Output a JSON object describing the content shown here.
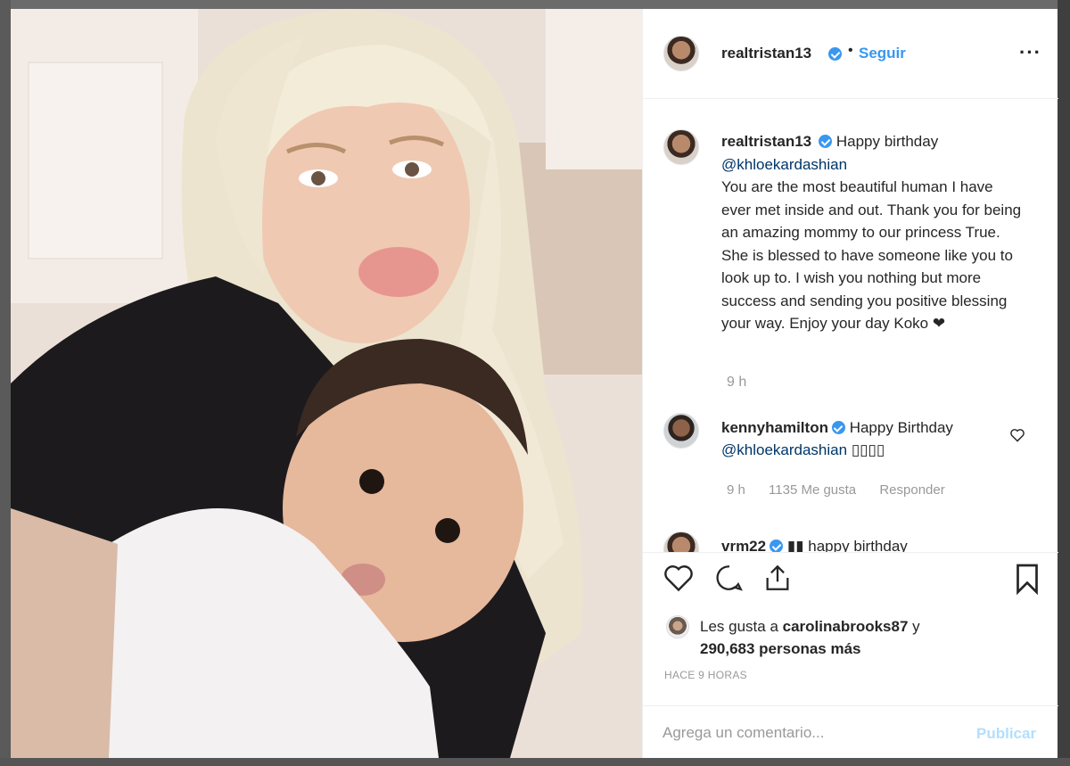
{
  "post": {
    "username": "realtristan13",
    "follow_label": "Seguir",
    "more_icon": "more-horizontal-icon",
    "dot": "•"
  },
  "caption": {
    "username": "realtristan13",
    "text_before": "Happy birthday",
    "mention": "@khloekardashian",
    "text_after": "You are the most beautiful human I have ever met inside and out. Thank you for being an amazing mommy to our princess True. She is blessed to have someone like you to look up to. I wish you nothing but more success and sending you positive blessing your way. Enjoy your day Koko",
    "heart": "❤",
    "time": "9 h"
  },
  "comments": [
    {
      "username": "kennyhamilton",
      "text": "Happy Birthday",
      "mention": "@khloekardashian",
      "emoji": "▯▯▯▯",
      "time": "9 h",
      "likes": "1135 Me gusta",
      "reply_label": "Responder"
    },
    {
      "username": "vrm22",
      "text": "▮▮ happy birthday"
    }
  ],
  "likes": {
    "prefix": "Les gusta a ",
    "user": "carolinabrooks87",
    "connector": " y",
    "count": "290,683 personas más"
  },
  "posted_time": "HACE 9 HORAS",
  "comment_box": {
    "placeholder": "Agrega un comentario...",
    "publish_label": "Publicar"
  },
  "colors": {
    "accent": "#3897f0",
    "publish_disabled": "#b2dffc",
    "muted": "#999999"
  }
}
